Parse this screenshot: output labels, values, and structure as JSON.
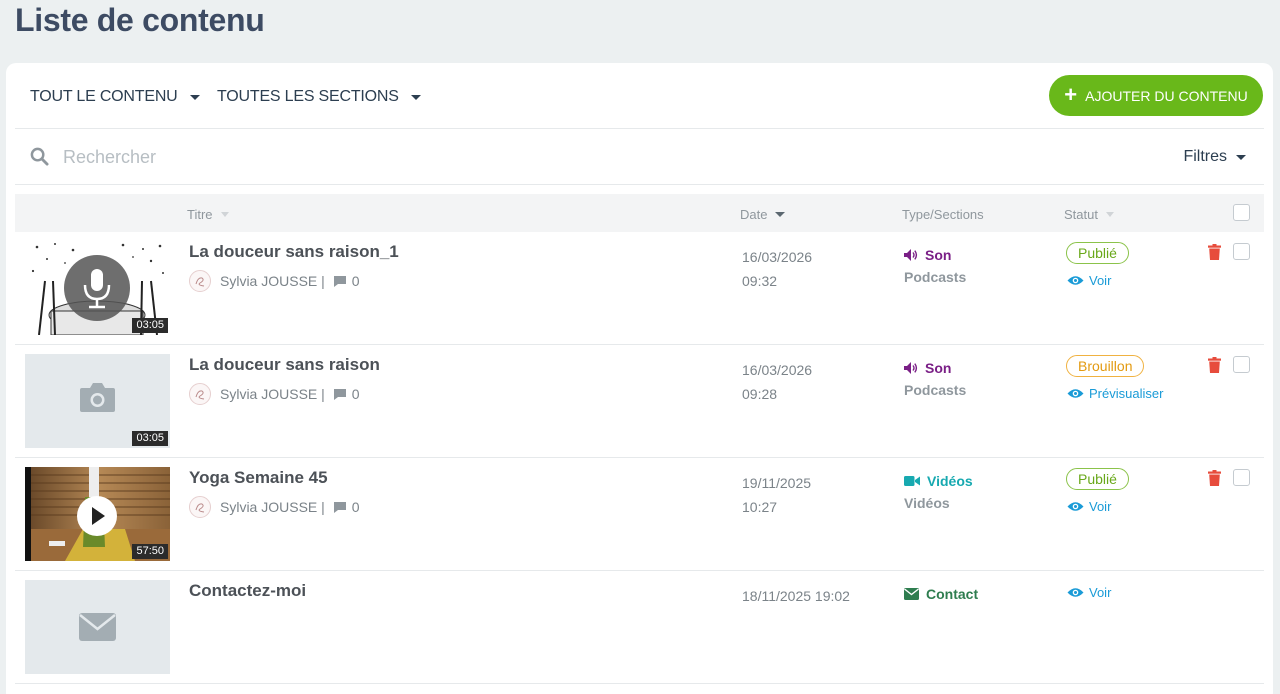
{
  "page": {
    "title": "Liste de contenu"
  },
  "toolbar": {
    "content_filter": "TOUT LE CONTENU",
    "section_filter": "TOUTES LES SECTIONS",
    "add_button": "AJOUTER DU CONTENU"
  },
  "search": {
    "placeholder": "Rechercher",
    "filters_label": "Filtres"
  },
  "table": {
    "headers": {
      "title": "Titre",
      "date": "Date",
      "type": "Type/Sections",
      "status": "Statut"
    },
    "rows": [
      {
        "title": "La douceur sans raison_1",
        "author": "Sylvia JOUSSE |",
        "comments": "0",
        "duration": "03:05",
        "date_line1": "16/03/2026",
        "date_line2": "09:32",
        "type": "Son",
        "type_icon": "speaker-icon",
        "type_color": "#7a1f86",
        "section": "Podcasts",
        "status": "Publié",
        "action": "Voir",
        "thumb": "podcast-illustration"
      },
      {
        "title": "La douceur sans raison",
        "author": "Sylvia JOUSSE |",
        "comments": "0",
        "duration": "03:05",
        "date_line1": "16/03/2026",
        "date_line2": "09:28",
        "type": "Son",
        "type_icon": "speaker-icon",
        "type_color": "#7a1f86",
        "section": "Podcasts",
        "status": "Brouillon",
        "action": "Prévisualiser",
        "thumb": "camera-placeholder"
      },
      {
        "title": "Yoga Semaine 45",
        "author": "Sylvia JOUSSE |",
        "comments": "0",
        "duration": "57:50",
        "date_line1": "19/11/2025",
        "date_line2": "10:27",
        "type": "Vidéos",
        "type_icon": "video-camera-icon",
        "type_color": "#17a9b0",
        "section": "Vidéos",
        "status": "Publié",
        "action": "Voir",
        "thumb": "video-thumbnail"
      },
      {
        "title": "Contactez-moi",
        "date_line1": "18/11/2025 19:02",
        "type": "Contact",
        "type_icon": "envelope-icon",
        "type_color": "#2e7d4f",
        "action": "Voir",
        "thumb": "envelope-placeholder"
      }
    ]
  },
  "colors": {
    "accent_green": "#69b81a",
    "link_blue": "#1a9bd7",
    "danger_red": "#e74c3c"
  }
}
